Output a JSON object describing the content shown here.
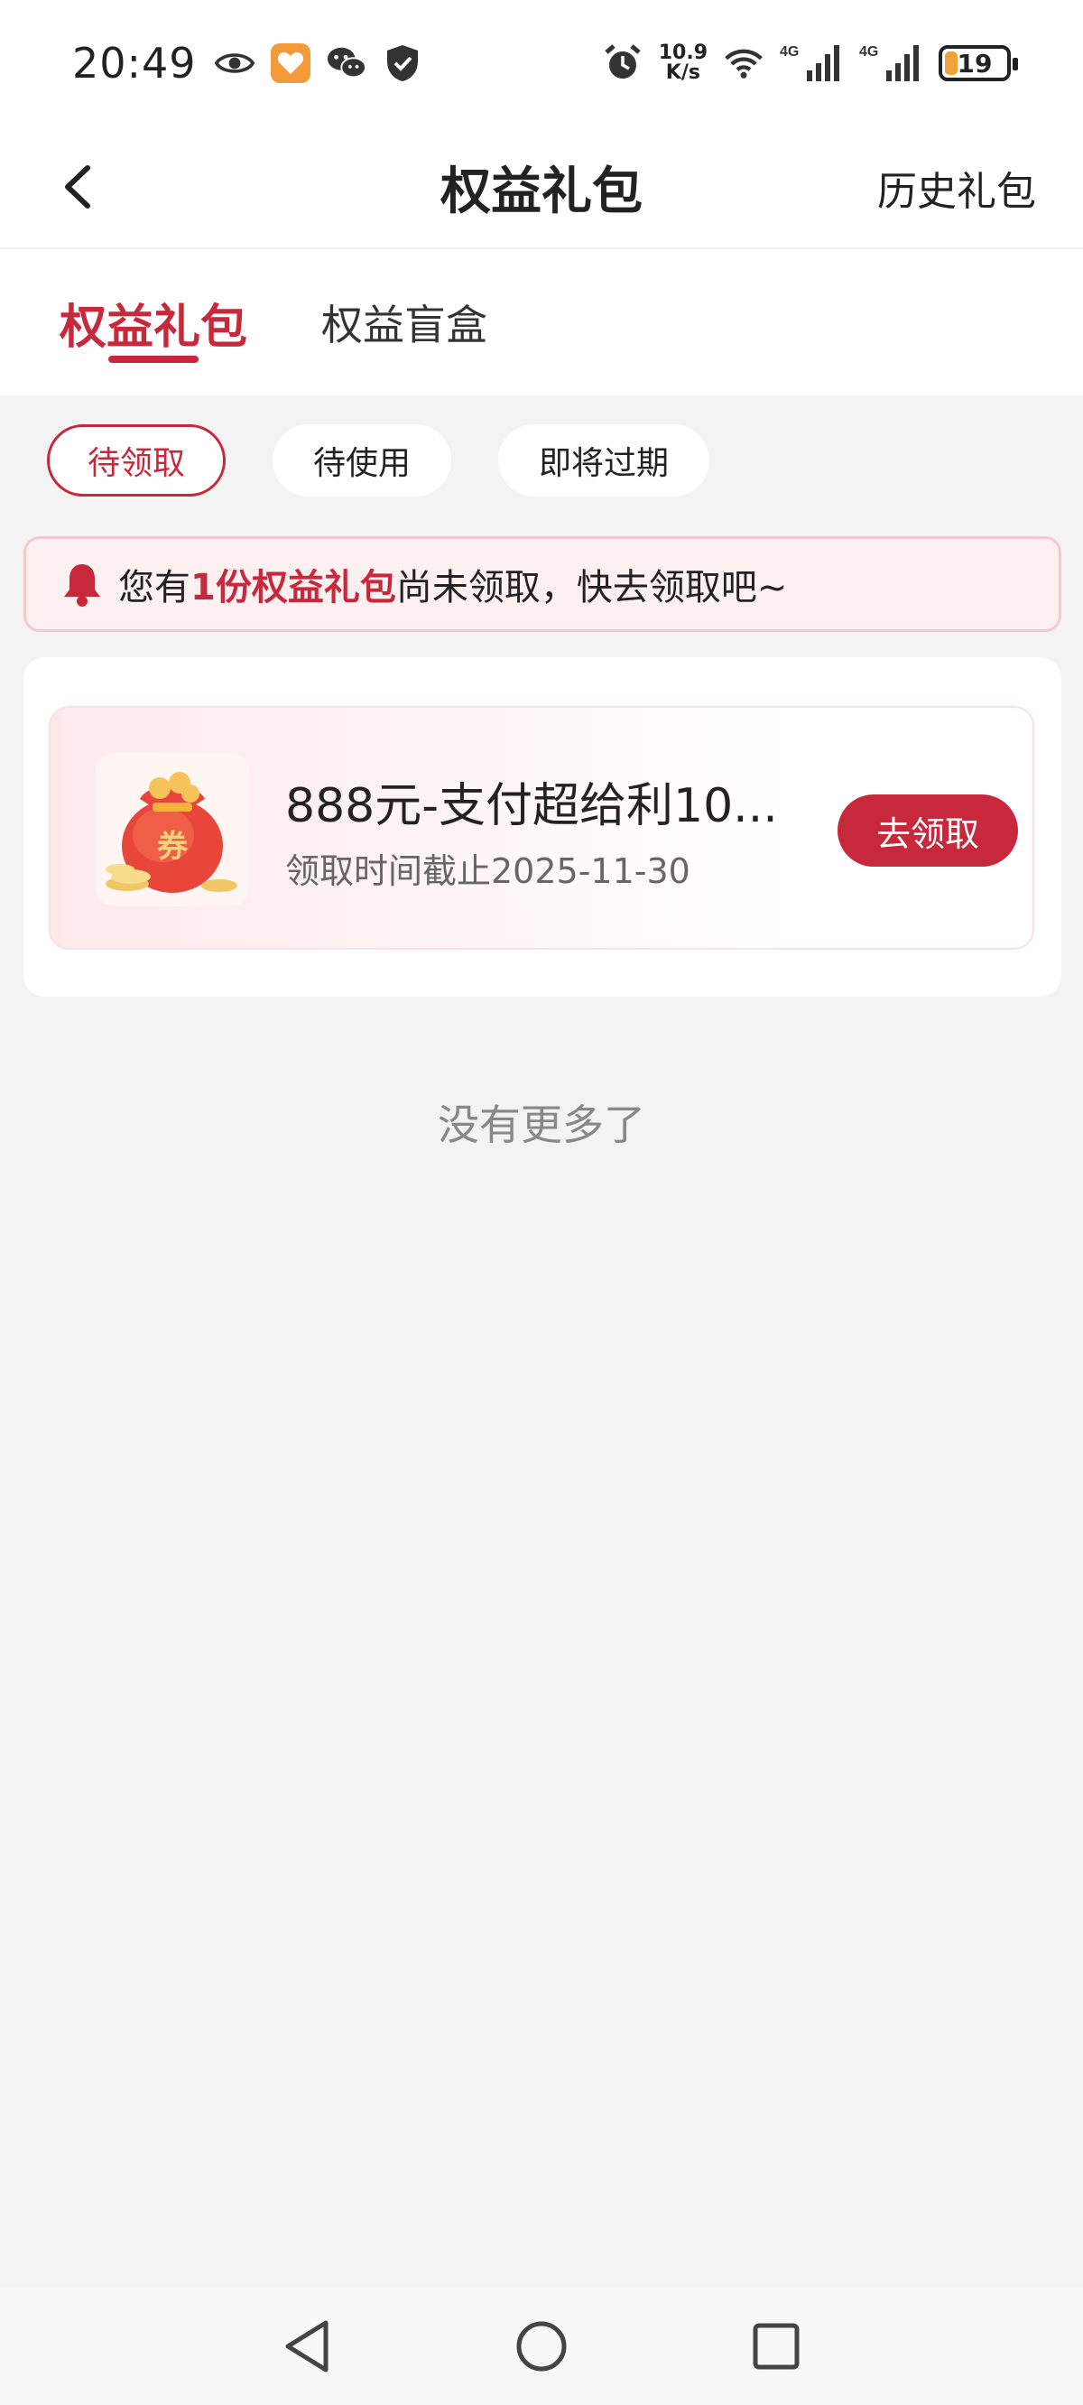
{
  "status_bar": {
    "time": "20:49",
    "net_speed_value": "10.9",
    "net_speed_unit": "K/s",
    "signal_1_label": "4G",
    "signal_2_label": "4G",
    "battery": "19",
    "icons": [
      "eye-icon",
      "health-app-icon",
      "wechat-icon",
      "shield-check-icon",
      "alarm-icon",
      "wifi-icon",
      "signal-icon",
      "battery-icon"
    ],
    "colors": {
      "health_app": "#f39a3a",
      "battery_fill": "#f2a23a"
    }
  },
  "nav": {
    "title": "权益礼包",
    "history_label": "历史礼包",
    "back_icon": "chevron-left-icon"
  },
  "tabs": [
    {
      "label": "权益礼包",
      "active": true
    },
    {
      "label": "权益盲盒",
      "active": false
    }
  ],
  "filters": [
    {
      "label": "待领取",
      "active": true
    },
    {
      "label": "待使用",
      "active": false
    },
    {
      "label": "即将过期",
      "active": false
    }
  ],
  "notice": {
    "prefix": "您有",
    "highlight": "1份权益礼包",
    "suffix": "尚未领取，快去领取吧~",
    "icon": "bell-icon"
  },
  "gift_items": [
    {
      "title": "888元-支付超给利10...",
      "deadline": "领取时间截止2025-11-30",
      "button_label": "去领取",
      "thumb_badge": "券",
      "thumb_icon": "coupon-bag-icon"
    }
  ],
  "list_end_text": "没有更多了",
  "system_nav": {
    "back_icon": "triangle-back-icon",
    "home_icon": "circle-home-icon",
    "recent_icon": "square-recent-icon"
  },
  "theme": {
    "accent": "#c8283c",
    "background": "#f3f3f3"
  }
}
